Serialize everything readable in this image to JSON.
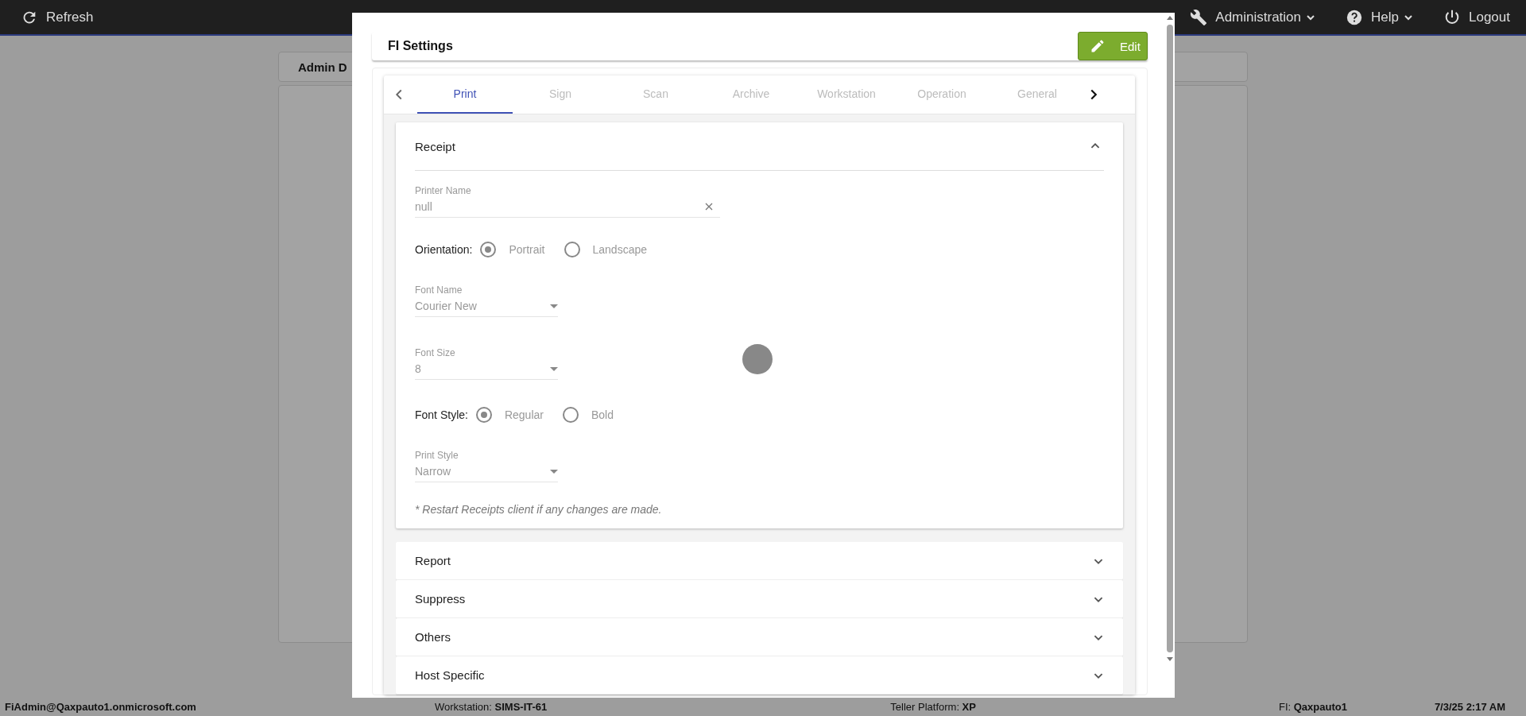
{
  "top_bar": {
    "refresh": "Refresh",
    "menus": [
      {
        "label": "Administration",
        "kind": "admin",
        "dropdown": true
      },
      {
        "label": "Help",
        "kind": "help",
        "dropdown": true
      },
      {
        "label": "Logout",
        "kind": "logout",
        "dropdown": false
      }
    ]
  },
  "background_card": {
    "title": "Admin D"
  },
  "dialog": {
    "title": "FI Settings",
    "edit_button": "Edit",
    "tabs": [
      {
        "label": "Print",
        "selected": true
      },
      {
        "label": "Sign",
        "selected": false
      },
      {
        "label": "Scan",
        "selected": false
      },
      {
        "label": "Archive",
        "selected": false
      },
      {
        "label": "Workstation",
        "selected": false
      },
      {
        "label": "Operation",
        "selected": false
      },
      {
        "label": "General",
        "selected": false
      }
    ],
    "sections": [
      {
        "title": "Receipt",
        "expanded": true,
        "fields": [
          {
            "kind": "text",
            "label": "Printer Name",
            "value": "null",
            "clearable": true
          },
          {
            "kind": "radio",
            "label": "Orientation:",
            "options": [
              {
                "label": "Portrait",
                "selected": true
              },
              {
                "label": "Landscape",
                "selected": false
              }
            ]
          },
          {
            "kind": "select",
            "label": "Font Name",
            "value": "Courier New"
          },
          {
            "kind": "select",
            "label": "Font Size",
            "value": "8"
          },
          {
            "kind": "radio",
            "label": "Font Style:",
            "options": [
              {
                "label": "Regular",
                "selected": true
              },
              {
                "label": "Bold",
                "selected": false
              }
            ]
          },
          {
            "kind": "select",
            "label": "Print Style",
            "value": "Narrow"
          }
        ],
        "note": "* Restart Receipts client if any changes are made."
      },
      {
        "title": "Report",
        "expanded": false
      },
      {
        "title": "Suppress",
        "expanded": false
      },
      {
        "title": "Others",
        "expanded": false
      },
      {
        "title": "Host Specific",
        "expanded": false
      }
    ]
  },
  "status_bar": {
    "user": "FiAdmin@Qaxpauto1.onmicrosoft.com",
    "workstation": "Workstation: **SIMS-IT-61**",
    "platform": "Teller Platform: **XP**",
    "fi": "FI: **Qaxpauto1**",
    "datetime": "7/3/25 2:17 AM"
  }
}
